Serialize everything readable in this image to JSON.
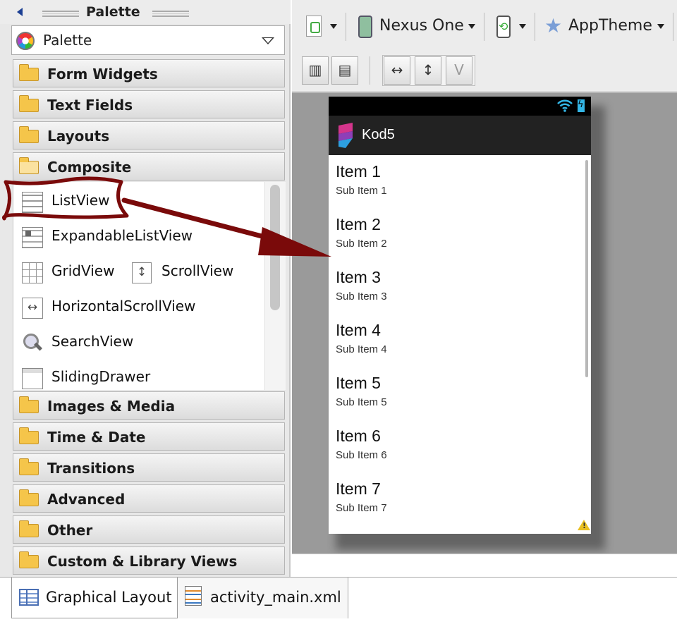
{
  "palette": {
    "title": "Palette",
    "dropdown_value": "Palette",
    "categories_top": [
      "Form Widgets",
      "Text Fields",
      "Layouts",
      "Composite"
    ],
    "composite_items": {
      "listview": "ListView",
      "expandable": "ExpandableListView",
      "gridview": "GridView",
      "scrollview": "ScrollView",
      "hscroll": "HorizontalScrollView",
      "searchview": "SearchView",
      "slidingdrawer": "SlidingDrawer"
    },
    "categories_bottom": [
      "Images & Media",
      "Time & Date",
      "Transitions",
      "Advanced",
      "Other",
      "Custom & Library Views"
    ]
  },
  "toolbar": {
    "device": "Nexus One",
    "theme": "AppTheme"
  },
  "preview": {
    "app_title": "Kod5",
    "items": [
      {
        "title": "Item 1",
        "sub": "Sub Item 1"
      },
      {
        "title": "Item 2",
        "sub": "Sub Item 2"
      },
      {
        "title": "Item 3",
        "sub": "Sub Item 3"
      },
      {
        "title": "Item 4",
        "sub": "Sub Item 4"
      },
      {
        "title": "Item 5",
        "sub": "Sub Item 5"
      },
      {
        "title": "Item 6",
        "sub": "Sub Item 6"
      },
      {
        "title": "Item 7",
        "sub": "Sub Item 7"
      }
    ]
  },
  "tabs": {
    "graphical": "Graphical Layout",
    "xml": "activity_main.xml"
  },
  "colors": {
    "highlight": "#7a0a0a",
    "action_bar": "#222222",
    "canvas": "#9a9a9a",
    "folder": "#f5c54a"
  }
}
